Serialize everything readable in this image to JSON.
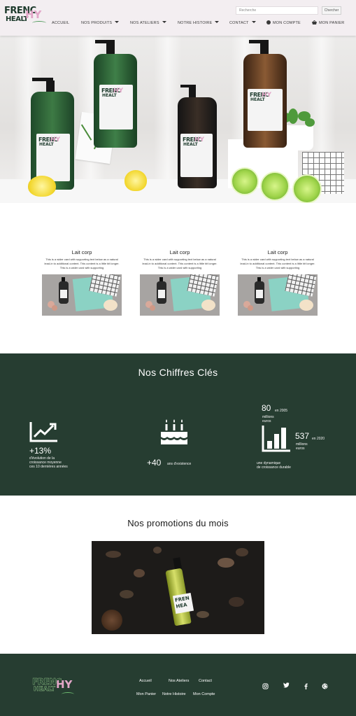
{
  "header": {
    "logo": {
      "line1": "FRENC",
      "line2": "HEALT",
      "accent": "HY"
    },
    "search": {
      "placeholder": "Recherche",
      "button": "Chercher"
    },
    "nav": [
      {
        "label": "ACCUEIL",
        "dropdown": false
      },
      {
        "label": "NOS PRODUITS",
        "dropdown": true
      },
      {
        "label": "NOS ATELIERS",
        "dropdown": true
      },
      {
        "label": "NOTRE HISTOIRE",
        "dropdown": true
      },
      {
        "label": "CONTACT",
        "dropdown": true
      },
      {
        "label": "MON COMPTE",
        "icon": "user-circle-icon"
      },
      {
        "label": "MON PANIER",
        "icon": "basket-icon"
      }
    ]
  },
  "hero": {
    "product_label": {
      "line1": "FRENC",
      "line2": "HEALT",
      "accent": "HY"
    }
  },
  "cards": [
    {
      "title": "Lait corp",
      "text": "This is a wider card with supporting text below as a natural lead-in to additional content. This content is a little bit longer. This is a wider card with supporting"
    },
    {
      "title": "Lait corp",
      "text": "This is a wider card with supporting text below as a natural lead-in to additional content. This content is a little bit longer. This is a wider card with supporting"
    },
    {
      "title": "Lait corp",
      "text": "This is a wider card with supporting text below as a natural lead-in to additional content. This content is a little bit longer. This is a wider card with supporting"
    }
  ],
  "stats": {
    "title": "Nos Chiffres Clés",
    "growth": {
      "value": "+13%",
      "desc1": "d'évolution de la",
      "desc2": "croissance moyenne",
      "desc3": "ces 10 dernières années",
      "icon": "trending-up-icon"
    },
    "years": {
      "value": "+40",
      "desc": "ans d'existence",
      "icon": "birthday-cake-icon"
    },
    "revenue": {
      "value_2005": "80",
      "year_2005": "en 2005",
      "unit_2005_a": "millions",
      "unit_2005_b": "euros",
      "value_2020": "537",
      "year_2020": "en 2020",
      "unit_2020_a": "millions",
      "unit_2020_b": "euros",
      "desc1": "une dynamique",
      "desc2": "de croissance durable",
      "icon": "bar-chart-icon"
    }
  },
  "promotions": {
    "title": "Nos promotions du mois",
    "label_text": "FREN",
    "label_text2": "HEA"
  },
  "footer": {
    "logo": {
      "line1": "FRENC",
      "line2": "HEALT",
      "accent": "HY"
    },
    "links_row1": [
      "Accueil",
      "Nos Ateliers",
      "Contact"
    ],
    "links_row2": [
      "Mon Panier",
      "Notre Histoire",
      "Mon Compte"
    ],
    "social": [
      "instagram-icon",
      "twitter-icon",
      "facebook-icon",
      "globe-icon"
    ]
  },
  "colors": {
    "header_bg": "#f3eef1",
    "dark_green": "#263d31",
    "accent_pink": "#e2a6c8"
  }
}
